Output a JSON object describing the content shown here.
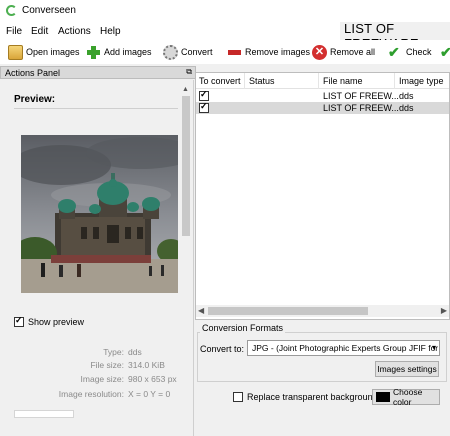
{
  "window": {
    "title": "Converseen",
    "watermark": "LIST OF FREEWARE"
  },
  "menu": [
    "File",
    "Edit",
    "Actions",
    "Help"
  ],
  "toolbar": {
    "open": "Open images",
    "add": "Add images",
    "convert": "Convert",
    "remove": "Remove images",
    "remove_all": "Remove all",
    "check": "Check"
  },
  "actions_panel": {
    "title": "Actions Panel",
    "preview_label": "Preview:",
    "show_preview_label": "Show preview",
    "show_preview_checked": true,
    "info": [
      {
        "key": "Type:",
        "value": "dds"
      },
      {
        "key": "File size:",
        "value": "314.0 KiB"
      },
      {
        "key": "Image size:",
        "value": "980 x 653 px"
      },
      {
        "key": "Image resolution:",
        "value": "X = 0 Y = 0"
      }
    ]
  },
  "list": {
    "columns": [
      "To convert",
      "Status",
      "File name",
      "Image type"
    ],
    "rows": [
      {
        "checked": true,
        "status": "",
        "file_name": "LIST OF FREEW...",
        "type": "dds",
        "selected": false
      },
      {
        "checked": true,
        "status": "",
        "file_name": "LIST OF FREEW...",
        "type": "dds",
        "selected": true
      }
    ]
  },
  "conversion": {
    "title": "Conversion Formats",
    "convert_to_label": "Convert to:",
    "format_value": "JPG - (Joint Photographic Experts Group JFIF for",
    "images_settings": "Images settings",
    "replace_label": "Replace transparent background",
    "replace_checked": false,
    "choose_color": "Choose color",
    "background_color": "#000000"
  }
}
